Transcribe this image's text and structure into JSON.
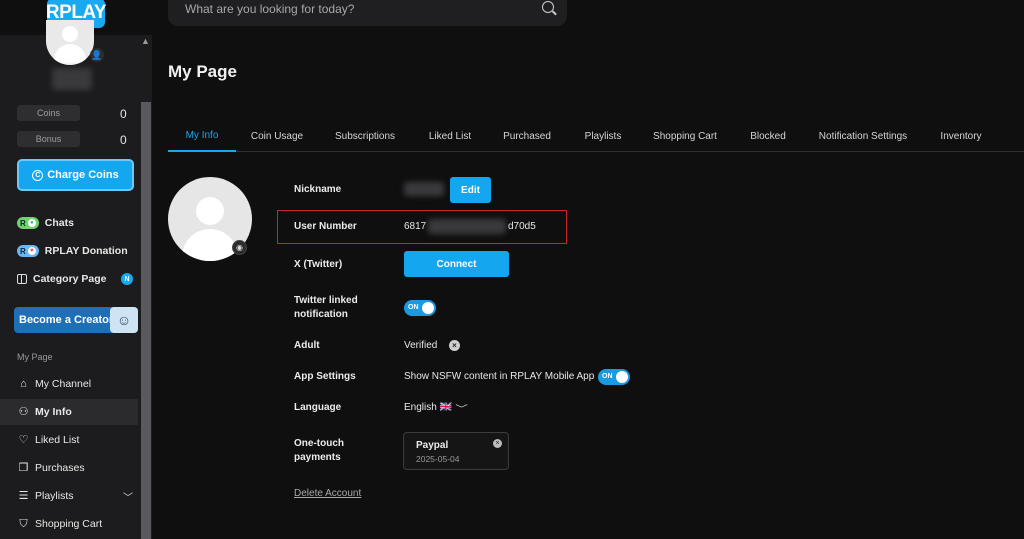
{
  "brand": {
    "logo_text": "RPLAY",
    "accent": "#14a6ef"
  },
  "search": {
    "placeholder": "What are you looking for today?",
    "icon": "search-icon"
  },
  "sidebar": {
    "coins_label": "Coins",
    "coins_value": "0",
    "bonus_label": "Bonus",
    "bonus_value": "0",
    "charge_label": "Charge Coins",
    "chats_label": "Chats",
    "donation_label": "RPLAY Donation",
    "category_label": "Category Page",
    "category_badge": "N",
    "creator_label": "Become a Creator",
    "section_label": "My Page",
    "nav": [
      {
        "label": "My Channel",
        "icon": "home-icon"
      },
      {
        "label": "My Info",
        "icon": "user-icon",
        "active": true
      },
      {
        "label": "Liked List",
        "icon": "heart-icon"
      },
      {
        "label": "Purchases",
        "icon": "copy-icon"
      },
      {
        "label": "Playlists",
        "icon": "playlist-icon"
      },
      {
        "label": "Shopping Cart",
        "icon": "cart-icon"
      }
    ]
  },
  "main": {
    "title": "My Page",
    "tabs": [
      "My Info",
      "Coin Usage",
      "Subscriptions",
      "Liked List",
      "Purchased",
      "Playlists",
      "Shopping Cart",
      "Blocked",
      "Notification Settings",
      "Inventory"
    ],
    "active_tab": "My Info",
    "fields": {
      "nickname_label": "Nickname",
      "edit_label": "Edit",
      "user_number_label": "User Number",
      "user_number_prefix": "6817",
      "user_number_suffix": "d70d5",
      "twitter_label": "X (Twitter)",
      "connect_label": "Connect",
      "twitter_notif_label_1": "Twitter linked",
      "twitter_notif_label_2": "notification",
      "toggle_on": "ON",
      "adult_label": "Adult",
      "adult_value": "Verified",
      "app_settings_label": "App Settings",
      "app_settings_value": "Show NSFW content in RPLAY Mobile App",
      "language_label": "Language",
      "language_value": "English 🇬🇧",
      "onetouch_label_1": "One-touch",
      "onetouch_label_2": "payments",
      "payment_name": "Paypal",
      "payment_date": "2025-05-04",
      "delete_label": "Delete Account"
    }
  }
}
